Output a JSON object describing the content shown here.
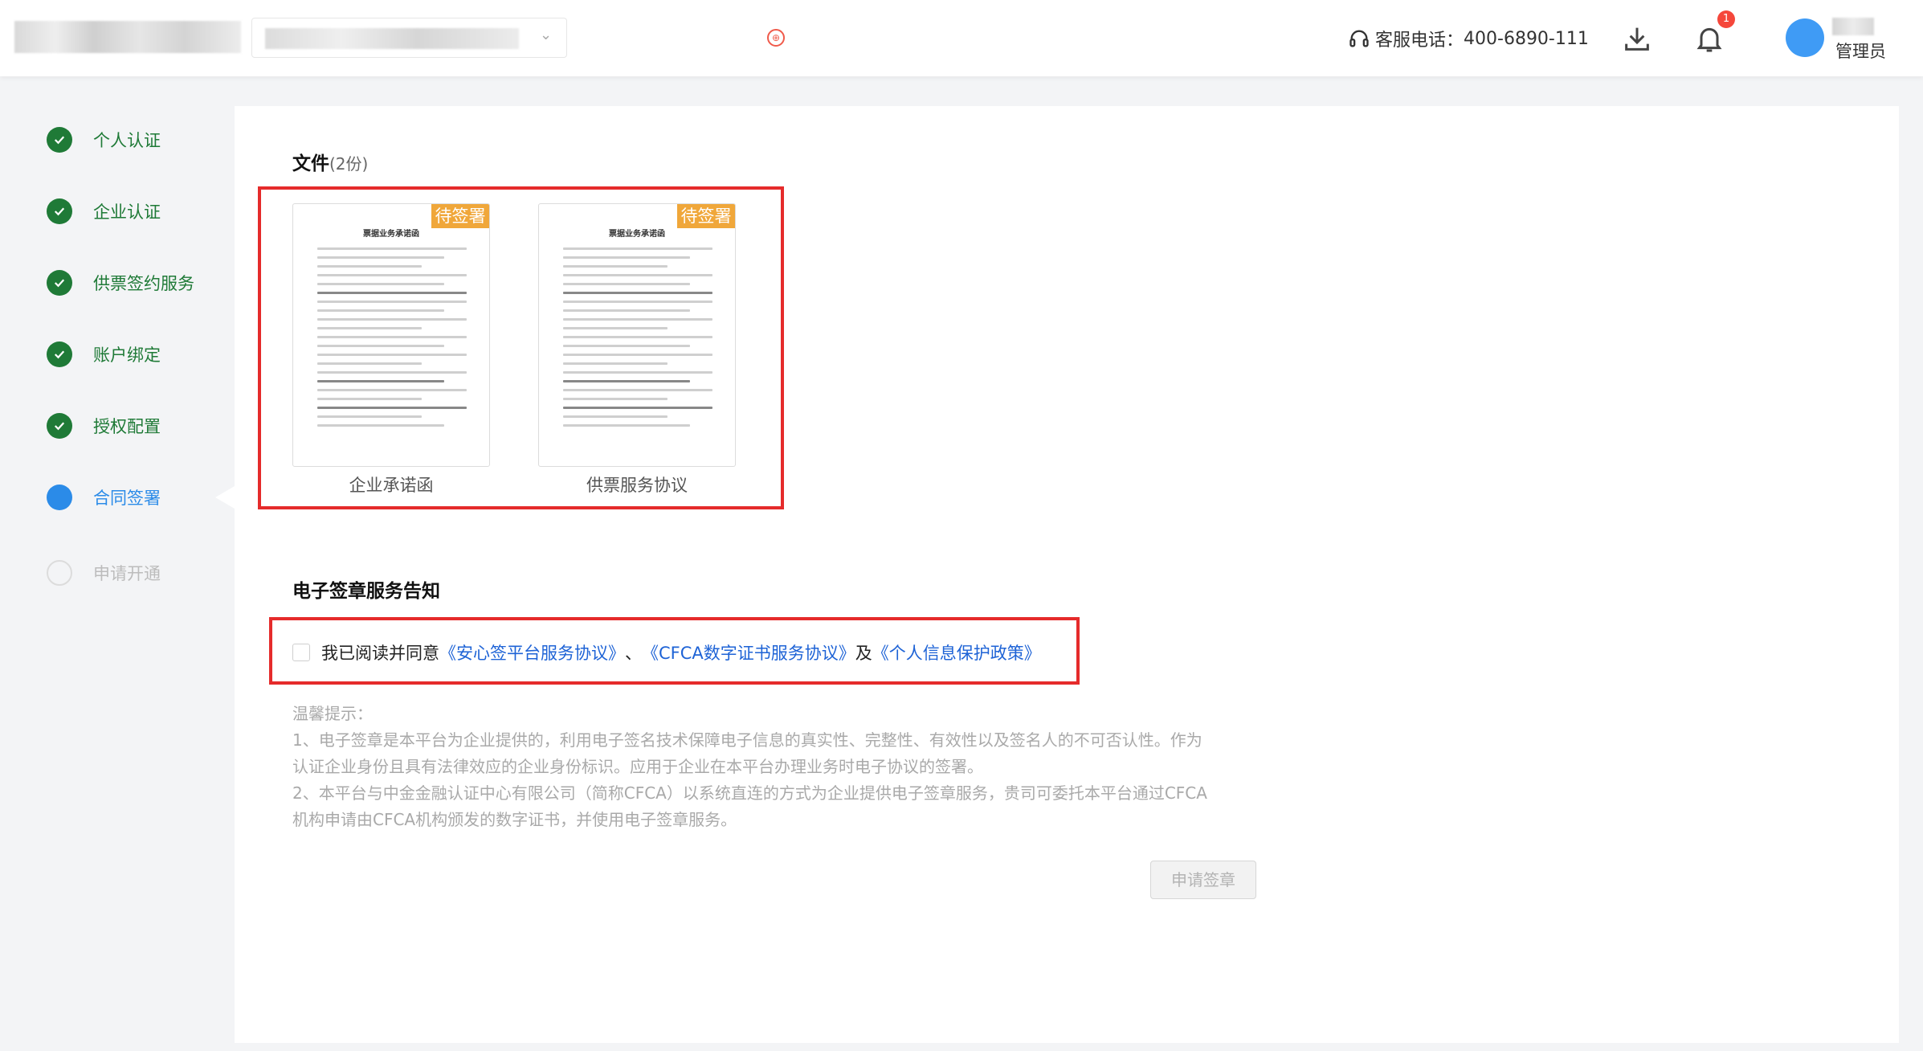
{
  "header": {
    "service_label": "客服电话：",
    "service_phone": "400-6890-111",
    "notification_count": "1",
    "user_role": "管理员",
    "download_icon": "download-icon",
    "bell_icon": "bell-icon",
    "headset_icon": "headset-icon"
  },
  "steps": [
    {
      "label": "个人认证",
      "state": "done"
    },
    {
      "label": "企业认证",
      "state": "done"
    },
    {
      "label": "供票签约服务",
      "state": "done"
    },
    {
      "label": "账户绑定",
      "state": "done"
    },
    {
      "label": "授权配置",
      "state": "done"
    },
    {
      "label": "合同签署",
      "state": "active"
    },
    {
      "label": "申请开通",
      "state": "todo"
    }
  ],
  "files": {
    "title": "文件",
    "count": "(2份)",
    "items": [
      {
        "name": "企业承诺函",
        "tag": "待签署",
        "doc_title": "票据业务承诺函"
      },
      {
        "name": "供票服务协议",
        "tag": "待签署",
        "doc_title": "票据业务承诺函"
      }
    ]
  },
  "esign": {
    "title": "电子签章服务告知",
    "agree_prefix": "我已阅读并同意",
    "link1": "《安心签平台服务协议》",
    "sep1": "、",
    "link2": "《CFCA数字证书服务协议》",
    "sep2": "及",
    "link3": "《个人信息保护政策》"
  },
  "tips": {
    "heading": "温馨提示：",
    "line1": "1、电子签章是本平台为企业提供的，利用电子签名技术保障电子信息的真实性、完整性、有效性以及签名人的不可否认性。作为",
    "line2": "认证企业身份且具有法律效应的企业身份标识。应用于企业在本平台办理业务时电子协议的签署。",
    "line3": "2、本平台与中金金融认证中心有限公司（简称CFCA）以系统直连的方式为企业提供电子签章服务，贵司可委托本平台通过CFCA",
    "line4": "机构申请由CFCA机构颁发的数字证书，并使用电子签章服务。"
  },
  "apply_button": "申请签章",
  "colors": {
    "done": "#1f7a37",
    "active": "#2b8be8",
    "tag": "#f0a73a",
    "link": "#1e63d6",
    "highlight": "#e52b2b"
  }
}
